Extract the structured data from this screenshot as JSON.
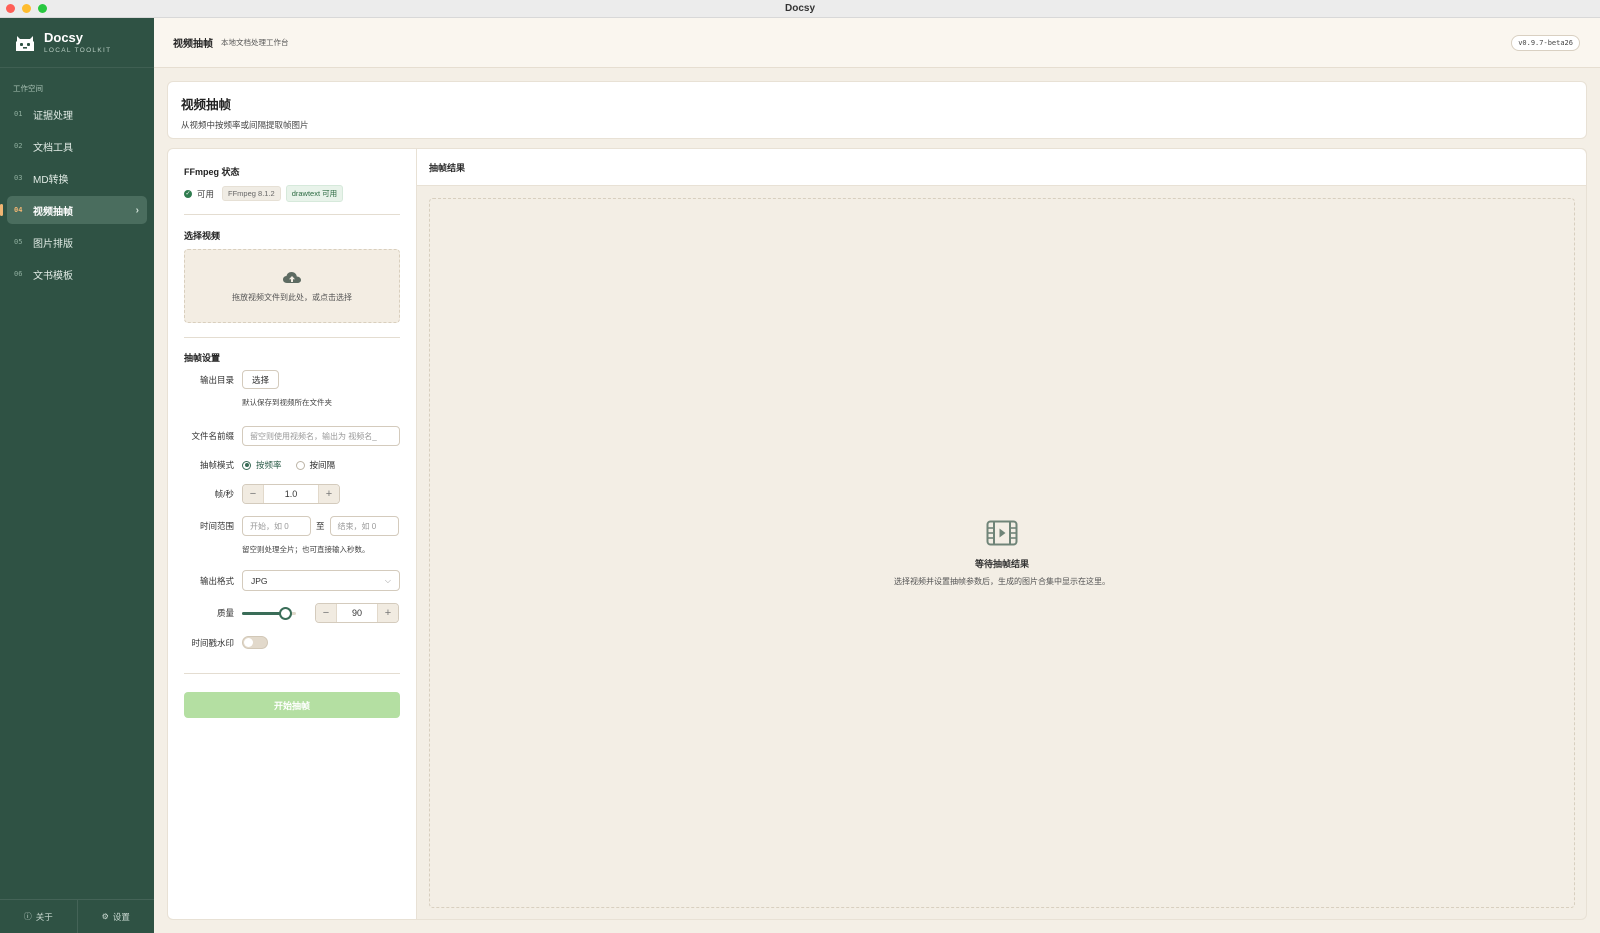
{
  "window": {
    "title": "Docsy"
  },
  "brand": {
    "name": "Docsy",
    "subtitle": "LOCAL TOOLKIT",
    "icon": "toolbox-icon"
  },
  "sidebar": {
    "group_title": "工作空间",
    "items": [
      {
        "num": "01",
        "label": "证据处理"
      },
      {
        "num": "02",
        "label": "文档工具"
      },
      {
        "num": "03",
        "label": "MD转换"
      },
      {
        "num": "04",
        "label": "视频抽帧",
        "active": true
      },
      {
        "num": "05",
        "label": "图片排版"
      },
      {
        "num": "06",
        "label": "文书模板"
      }
    ],
    "footer": {
      "about": "关于",
      "settings": "设置"
    }
  },
  "topbar": {
    "title": "视频抽帧",
    "subtitle": "本地文档处理工作台",
    "version": "v0.9.7-beta26"
  },
  "page": {
    "title": "视频抽帧",
    "description": "从视频中按频率或间隔提取帧图片"
  },
  "ffmpeg": {
    "title": "FFmpeg 状态",
    "status": "可用",
    "version_tag": "FFmpeg 8.1.2",
    "drawtext_tag": "drawtext 可用"
  },
  "video_select": {
    "title": "选择视频",
    "drop_text": "拖放视频文件到此处，或点击选择"
  },
  "settings": {
    "title": "抽帧设置",
    "output_dir": {
      "label": "输出目录",
      "button": "选择",
      "hint": "默认保存到视频所在文件夹"
    },
    "prefix": {
      "label": "文件名前缀",
      "placeholder": "留空则使用视频名，输出为 视频名_"
    },
    "mode": {
      "label": "抽帧模式",
      "options": [
        "按频率",
        "按间隔"
      ],
      "selected": "按频率"
    },
    "fps": {
      "label": "帧/秒",
      "value": "1.0",
      "minus": "−",
      "plus": "+"
    },
    "time_range": {
      "label": "时间范围",
      "start_placeholder": "开始，如 0",
      "to": "至",
      "end_placeholder": "结束，如 0",
      "hint": "留空则处理全片；也可直接输入秒数。"
    },
    "format": {
      "label": "输出格式",
      "value": "JPG"
    },
    "quality": {
      "label": "质量",
      "value": "90",
      "fraction": 0.9,
      "minus": "−",
      "plus": "+"
    },
    "watermark": {
      "label": "时间戳水印",
      "enabled": false
    }
  },
  "start_button": "开始抽帧",
  "results": {
    "title": "抽帧结果",
    "empty_title": "等待抽帧结果",
    "empty_desc": "选择视频并设置抽帧参数后，生成的图片合集中显示在这里。",
    "icon": "film-play-icon"
  },
  "colors": {
    "sidebar": "#2f5244",
    "accent": "#3a6d58",
    "highlight": "#f2b673",
    "start_button": "#b4dfa2"
  }
}
